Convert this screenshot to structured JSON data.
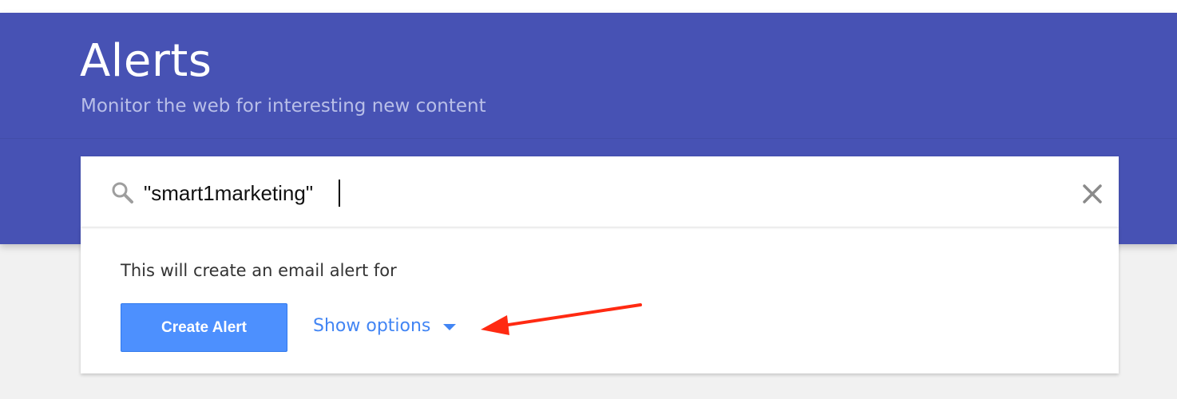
{
  "header": {
    "title": "Alerts",
    "subtitle": "Monitor the web for interesting new content",
    "background_color": "#4752b4"
  },
  "search": {
    "value": "\"smart1marketing\"",
    "icon": "search-icon",
    "clear_icon": "close-icon"
  },
  "panel": {
    "preview_text": "This will create an email alert for ",
    "create_button_label": "Create Alert",
    "show_options_label": "Show options",
    "show_options_icon": "caret-down-icon",
    "button_color": "#4d90fe",
    "link_color": "#4285f4"
  },
  "annotation": {
    "arrow_color": "#ff2a12",
    "points_to": "show-options-link"
  }
}
